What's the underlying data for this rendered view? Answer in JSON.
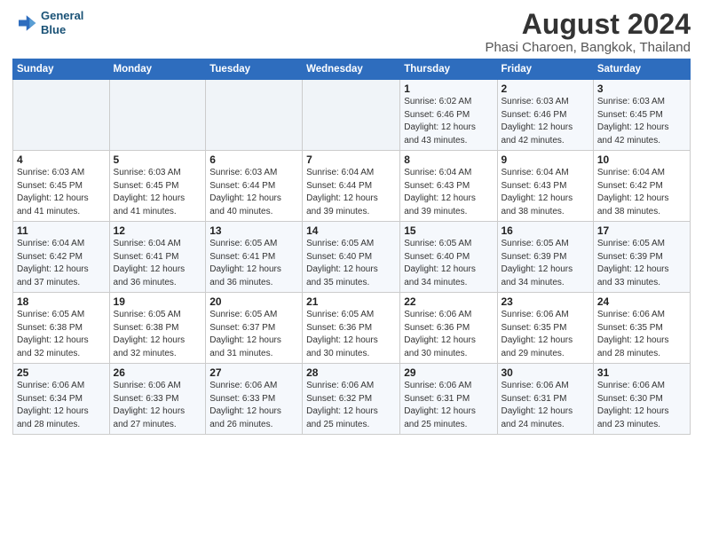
{
  "header": {
    "logo_line1": "General",
    "logo_line2": "Blue",
    "title": "August 2024",
    "subtitle": "Phasi Charoen, Bangkok, Thailand"
  },
  "weekdays": [
    "Sunday",
    "Monday",
    "Tuesday",
    "Wednesday",
    "Thursday",
    "Friday",
    "Saturday"
  ],
  "weeks": [
    [
      {
        "day": "",
        "info": ""
      },
      {
        "day": "",
        "info": ""
      },
      {
        "day": "",
        "info": ""
      },
      {
        "day": "",
        "info": ""
      },
      {
        "day": "1",
        "info": "Sunrise: 6:02 AM\nSunset: 6:46 PM\nDaylight: 12 hours\nand 43 minutes."
      },
      {
        "day": "2",
        "info": "Sunrise: 6:03 AM\nSunset: 6:46 PM\nDaylight: 12 hours\nand 42 minutes."
      },
      {
        "day": "3",
        "info": "Sunrise: 6:03 AM\nSunset: 6:45 PM\nDaylight: 12 hours\nand 42 minutes."
      }
    ],
    [
      {
        "day": "4",
        "info": "Sunrise: 6:03 AM\nSunset: 6:45 PM\nDaylight: 12 hours\nand 41 minutes."
      },
      {
        "day": "5",
        "info": "Sunrise: 6:03 AM\nSunset: 6:45 PM\nDaylight: 12 hours\nand 41 minutes."
      },
      {
        "day": "6",
        "info": "Sunrise: 6:03 AM\nSunset: 6:44 PM\nDaylight: 12 hours\nand 40 minutes."
      },
      {
        "day": "7",
        "info": "Sunrise: 6:04 AM\nSunset: 6:44 PM\nDaylight: 12 hours\nand 39 minutes."
      },
      {
        "day": "8",
        "info": "Sunrise: 6:04 AM\nSunset: 6:43 PM\nDaylight: 12 hours\nand 39 minutes."
      },
      {
        "day": "9",
        "info": "Sunrise: 6:04 AM\nSunset: 6:43 PM\nDaylight: 12 hours\nand 38 minutes."
      },
      {
        "day": "10",
        "info": "Sunrise: 6:04 AM\nSunset: 6:42 PM\nDaylight: 12 hours\nand 38 minutes."
      }
    ],
    [
      {
        "day": "11",
        "info": "Sunrise: 6:04 AM\nSunset: 6:42 PM\nDaylight: 12 hours\nand 37 minutes."
      },
      {
        "day": "12",
        "info": "Sunrise: 6:04 AM\nSunset: 6:41 PM\nDaylight: 12 hours\nand 36 minutes."
      },
      {
        "day": "13",
        "info": "Sunrise: 6:05 AM\nSunset: 6:41 PM\nDaylight: 12 hours\nand 36 minutes."
      },
      {
        "day": "14",
        "info": "Sunrise: 6:05 AM\nSunset: 6:40 PM\nDaylight: 12 hours\nand 35 minutes."
      },
      {
        "day": "15",
        "info": "Sunrise: 6:05 AM\nSunset: 6:40 PM\nDaylight: 12 hours\nand 34 minutes."
      },
      {
        "day": "16",
        "info": "Sunrise: 6:05 AM\nSunset: 6:39 PM\nDaylight: 12 hours\nand 34 minutes."
      },
      {
        "day": "17",
        "info": "Sunrise: 6:05 AM\nSunset: 6:39 PM\nDaylight: 12 hours\nand 33 minutes."
      }
    ],
    [
      {
        "day": "18",
        "info": "Sunrise: 6:05 AM\nSunset: 6:38 PM\nDaylight: 12 hours\nand 32 minutes."
      },
      {
        "day": "19",
        "info": "Sunrise: 6:05 AM\nSunset: 6:38 PM\nDaylight: 12 hours\nand 32 minutes."
      },
      {
        "day": "20",
        "info": "Sunrise: 6:05 AM\nSunset: 6:37 PM\nDaylight: 12 hours\nand 31 minutes."
      },
      {
        "day": "21",
        "info": "Sunrise: 6:05 AM\nSunset: 6:36 PM\nDaylight: 12 hours\nand 30 minutes."
      },
      {
        "day": "22",
        "info": "Sunrise: 6:06 AM\nSunset: 6:36 PM\nDaylight: 12 hours\nand 30 minutes."
      },
      {
        "day": "23",
        "info": "Sunrise: 6:06 AM\nSunset: 6:35 PM\nDaylight: 12 hours\nand 29 minutes."
      },
      {
        "day": "24",
        "info": "Sunrise: 6:06 AM\nSunset: 6:35 PM\nDaylight: 12 hours\nand 28 minutes."
      }
    ],
    [
      {
        "day": "25",
        "info": "Sunrise: 6:06 AM\nSunset: 6:34 PM\nDaylight: 12 hours\nand 28 minutes."
      },
      {
        "day": "26",
        "info": "Sunrise: 6:06 AM\nSunset: 6:33 PM\nDaylight: 12 hours\nand 27 minutes."
      },
      {
        "day": "27",
        "info": "Sunrise: 6:06 AM\nSunset: 6:33 PM\nDaylight: 12 hours\nand 26 minutes."
      },
      {
        "day": "28",
        "info": "Sunrise: 6:06 AM\nSunset: 6:32 PM\nDaylight: 12 hours\nand 25 minutes."
      },
      {
        "day": "29",
        "info": "Sunrise: 6:06 AM\nSunset: 6:31 PM\nDaylight: 12 hours\nand 25 minutes."
      },
      {
        "day": "30",
        "info": "Sunrise: 6:06 AM\nSunset: 6:31 PM\nDaylight: 12 hours\nand 24 minutes."
      },
      {
        "day": "31",
        "info": "Sunrise: 6:06 AM\nSunset: 6:30 PM\nDaylight: 12 hours\nand 23 minutes."
      }
    ]
  ]
}
